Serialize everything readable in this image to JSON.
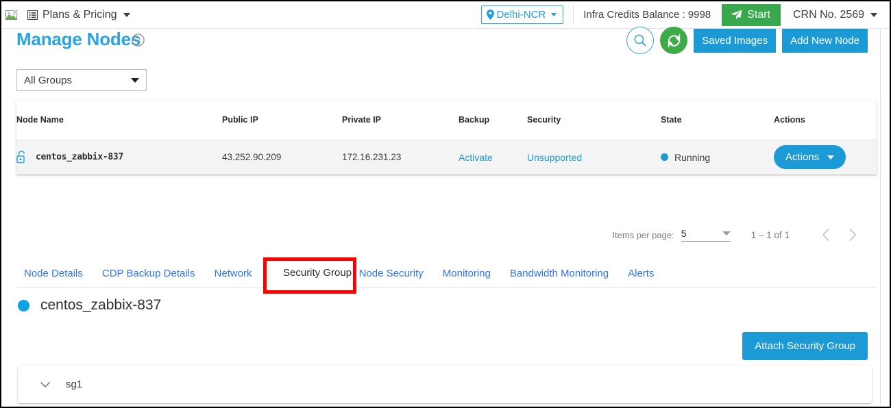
{
  "topbar": {
    "logo_icon": "broken-image-icon",
    "plans_menu": {
      "label": "Plans & Pricing",
      "icon": "list-icon",
      "caret": "chevron-down-icon"
    },
    "region": {
      "label": "Delhi-NCR",
      "icon": "location-pin-icon",
      "caret": "chevron-down-icon"
    },
    "credits": "Infra Credits Balance : 9998",
    "start_button": {
      "label": "Start",
      "icon": "send-plane-icon"
    },
    "crn": {
      "label": "CRN No. 2569",
      "caret": "chevron-down-icon"
    }
  },
  "page": {
    "title": "Manage Nodes",
    "help_icon": "question-mark-circle-icon",
    "search_icon": "search-icon",
    "refresh_icon": "refresh-icon",
    "saved_images_label": "Saved Images",
    "add_node_label": "Add New Node",
    "group_filter": {
      "value": "All Groups"
    }
  },
  "table": {
    "columns": [
      "Node Name",
      "Public IP",
      "Private IP",
      "Backup",
      "Security",
      "State",
      "Actions"
    ],
    "rows": [
      {
        "lock_icon": "unlocked-padlock-icon",
        "node_name": "centos_zabbix-837",
        "public_ip": "43.252.90.209",
        "private_ip": "172.16.231.23",
        "backup": "Activate",
        "security": "Unsupported",
        "state": "Running",
        "state_color": "#1b9ad6",
        "actions_label": "Actions"
      }
    ]
  },
  "paginator": {
    "items_per_page_label": "Items per page:",
    "items_per_page_value": "5",
    "range_label": "1 – 1 of 1",
    "prev_icon": "chevron-left-icon",
    "next_icon": "chevron-right-icon"
  },
  "tabs": {
    "items": [
      {
        "label": "Node Details",
        "active": false
      },
      {
        "label": "CDP Backup Details",
        "active": false
      },
      {
        "label": "Network",
        "active": false
      },
      {
        "label": "Security Group",
        "active": true
      },
      {
        "label": "Node Security",
        "active": false
      },
      {
        "label": "Monitoring",
        "active": false
      },
      {
        "label": "Bandwidth Monitoring",
        "active": false
      },
      {
        "label": "Alerts",
        "active": false
      }
    ],
    "highlight_color": "#ff0000"
  },
  "security_group_tab": {
    "node_label": "centos_zabbix-837",
    "node_dot_color": "#0aa2e8",
    "attach_button_label": "Attach Security Group",
    "groups": [
      {
        "name": "sg1",
        "expand_icon": "chevron-down-icon",
        "expanded": false
      }
    ]
  },
  "theme": {
    "primary_blue": "#1b9ad6",
    "title_blue": "#29a3e3",
    "link_blue": "#2f72f2",
    "green": "#39a84c"
  }
}
